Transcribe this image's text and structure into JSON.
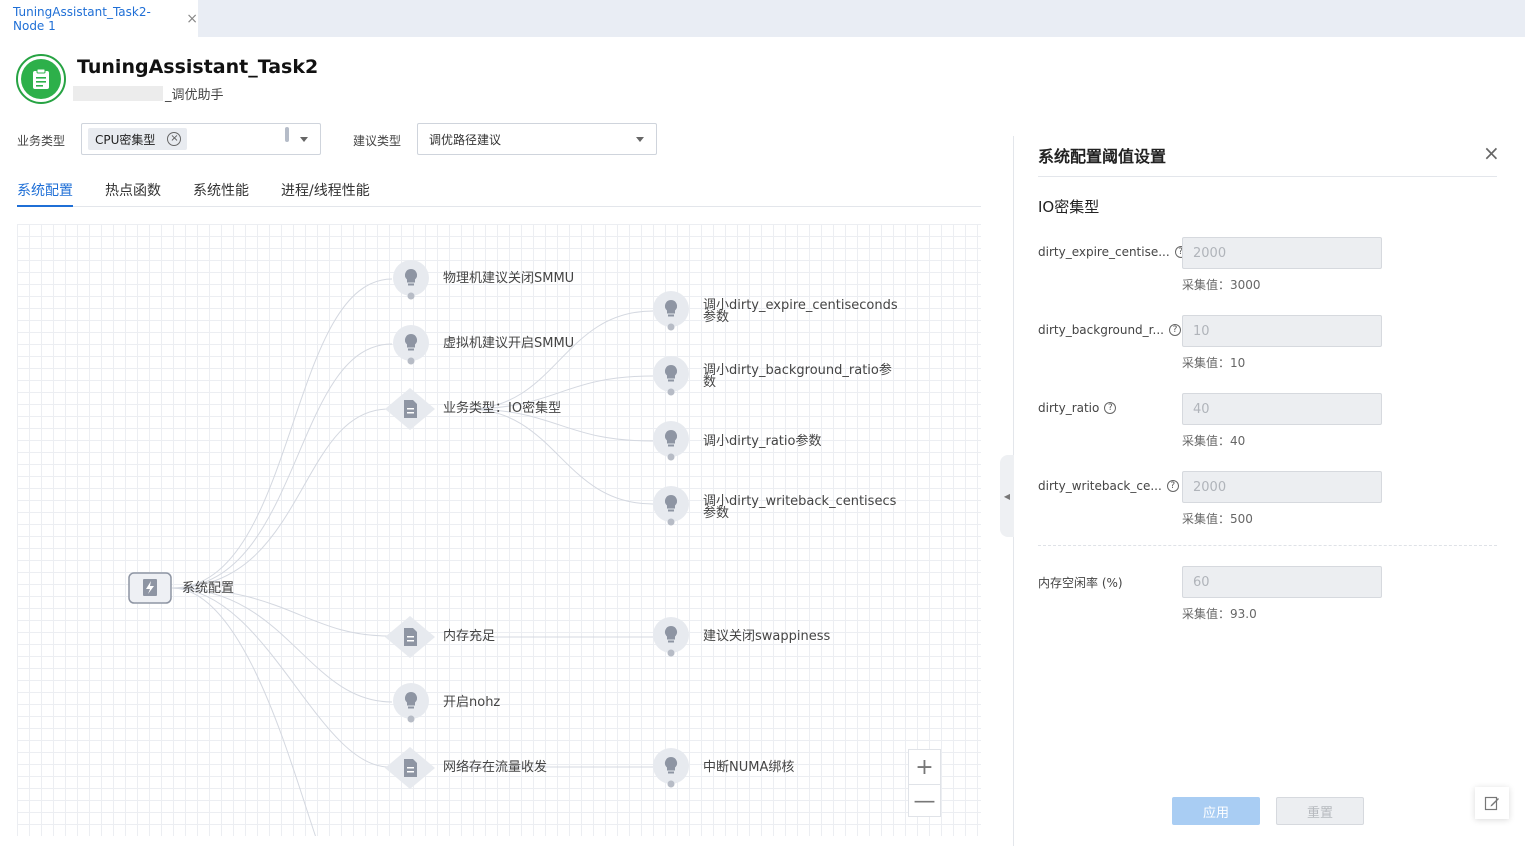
{
  "tab": {
    "label": "TuningAssistant_Task2-Node 1",
    "close": "×"
  },
  "header": {
    "title": "TuningAssistant_Task2",
    "subtitle": "_调优助手"
  },
  "filters": {
    "business_label": "业务类型",
    "business_chip": "CPU密集型",
    "suggest_label": "建议类型",
    "suggest_value": "调优路径建议"
  },
  "tabs": [
    "系统配置",
    "热点函数",
    "系统性能",
    "进程/线程性能"
  ],
  "graph": {
    "root": "系统配置",
    "level1": [
      "物理机建议关闭SMMU",
      "虚拟机建议开启SMMU",
      "业务类型：IO密集型",
      "内存充足",
      "开启nohz",
      "网络存在流量收发"
    ],
    "level2_io": [
      "调小dirty_expire_centiseconds",
      "参数",
      "调小dirty_background_ratio参",
      "数",
      "调小dirty_ratio参数",
      "调小dirty_writeback_centisecs",
      "参数"
    ],
    "level2_mem": "建议关闭swappiness",
    "level2_net": "中断NUMA绑核"
  },
  "zoom": {
    "in": "+",
    "out": "—"
  },
  "panel": {
    "title": "系统配置阈值设置",
    "close": "×",
    "section": "IO密集型",
    "fields": [
      {
        "label": "dirty_expire_centise...",
        "value": "2000",
        "hint": "采集值：3000"
      },
      {
        "label": "dirty_background_r...",
        "value": "10",
        "hint": "采集值：10"
      },
      {
        "label": "dirty_ratio",
        "value": "40",
        "hint": "采集值：40"
      },
      {
        "label": "dirty_writeback_ce...",
        "value": "2000",
        "hint": "采集值：500"
      }
    ],
    "memory_field": {
      "label": "内存空闲率 (%)",
      "value": "60",
      "hint": "采集值：93.0"
    },
    "apply": "应用",
    "reset": "重置",
    "help": "?"
  },
  "colors": {
    "accent": "#1f6fd6",
    "logo": "#2db04a",
    "edge": "#c9ced8",
    "node": "#8e95a3"
  },
  "icons": [
    "clipboard-icon",
    "lightbulb-icon",
    "document-icon",
    "lightning-icon",
    "edit-icon"
  ]
}
